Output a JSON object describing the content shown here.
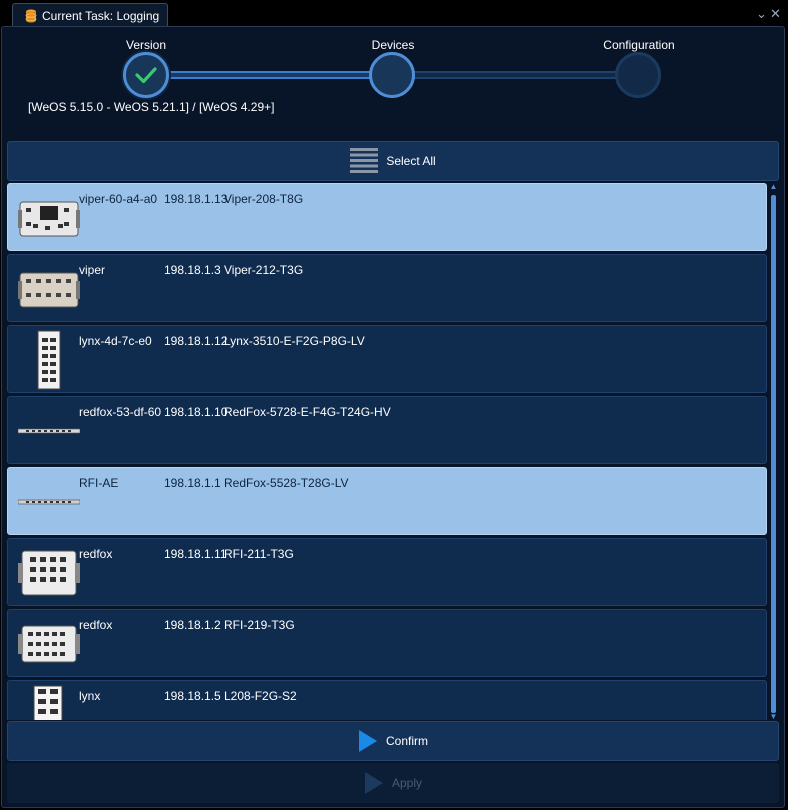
{
  "window": {
    "tab_title": "Current Task: Logging",
    "minimize_glyph": "⌄",
    "close_glyph": "✕"
  },
  "stepper": {
    "steps": [
      {
        "label": "Version",
        "state": "done"
      },
      {
        "label": "Devices",
        "state": "current"
      },
      {
        "label": "Configuration",
        "state": "pending"
      }
    ],
    "version_range": "[WeOS 5.15.0 - WeOS 5.21.1] / [WeOS 4.29+]"
  },
  "select_all_label": "Select All",
  "devices": [
    {
      "name": "viper-60-a4-a0",
      "ip": "198.18.1.13",
      "model": "Viper-208-T8G",
      "selected": true,
      "icon": "viper-device-icon"
    },
    {
      "name": "viper",
      "ip": "198.18.1.3",
      "model": "Viper-212-T3G",
      "selected": false,
      "icon": "viper-device-icon"
    },
    {
      "name": "lynx-4d-7c-e0",
      "ip": "198.18.1.12",
      "model": "Lynx-3510-E-F2G-P8G-LV",
      "selected": false,
      "icon": "lynx-device-icon"
    },
    {
      "name": "redfox-53-df-60",
      "ip": "198.18.1.10",
      "model": "RedFox-5728-E-F4G-T24G-HV",
      "selected": false,
      "icon": "rack-device-icon"
    },
    {
      "name": "RFI-AE",
      "ip": "198.18.1.1",
      "model": "RedFox-5528-T28G-LV",
      "selected": true,
      "icon": "rack-device-icon"
    },
    {
      "name": "redfox",
      "ip": "198.18.1.11",
      "model": "RFI-211-T3G",
      "selected": false,
      "icon": "rfi-device-icon"
    },
    {
      "name": "redfox",
      "ip": "198.18.1.2",
      "model": "RFI-219-T3G",
      "selected": false,
      "icon": "rfi-device-icon"
    },
    {
      "name": "lynx",
      "ip": "198.18.1.5",
      "model": "L208-F2G-S2",
      "selected": false,
      "icon": "lynx-device-icon"
    }
  ],
  "confirm_label": "Confirm",
  "apply_label": "Apply",
  "colors": {
    "background": "#081428",
    "row": "#0f2b4e",
    "row_selected": "#9ac2e8",
    "accent": "#1a8ae6",
    "check": "#3cc86e"
  }
}
